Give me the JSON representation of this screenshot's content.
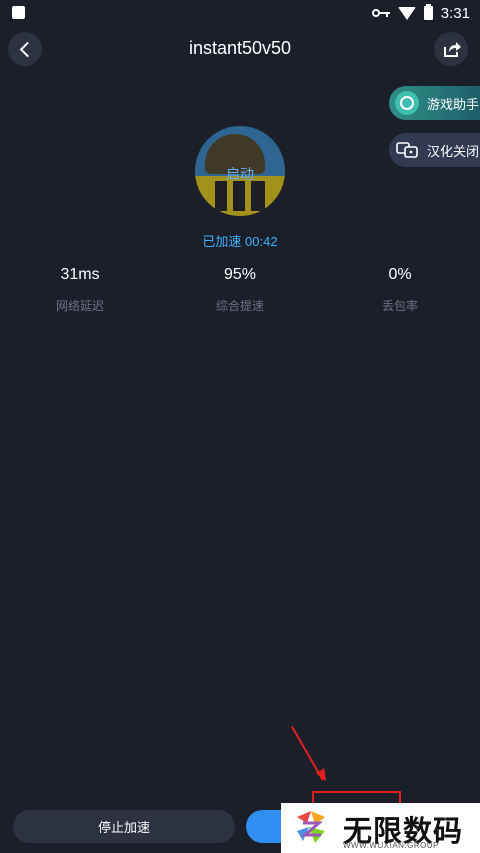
{
  "status_bar": {
    "time": "3:31"
  },
  "header": {
    "title": "instant50v50"
  },
  "side_actions": {
    "game_assistant": "游戏助手",
    "translation_off": "汉化关闭"
  },
  "game": {
    "start_label": "启动",
    "accel_status": "已加速 00:42"
  },
  "stats": [
    {
      "value": "31ms",
      "label": "网络延迟"
    },
    {
      "value": "95%",
      "label": "综合提速"
    },
    {
      "value": "0%",
      "label": "丢包率"
    }
  ],
  "bottom": {
    "stop_label": "停止加速"
  },
  "watermark": {
    "brand": "无限数码",
    "url": "WWW.WUXIAN.GROUP"
  },
  "colors": {
    "background": "#1b1f2a",
    "accent_blue": "#3eb0ff",
    "assistant_teal": "#2f8f86",
    "annotation_red": "#e02020"
  },
  "icons": [
    "back-arrow-icon",
    "share-icon",
    "game-assistant-icon",
    "translate-icon",
    "key-icon",
    "wifi-icon",
    "battery-icon"
  ]
}
